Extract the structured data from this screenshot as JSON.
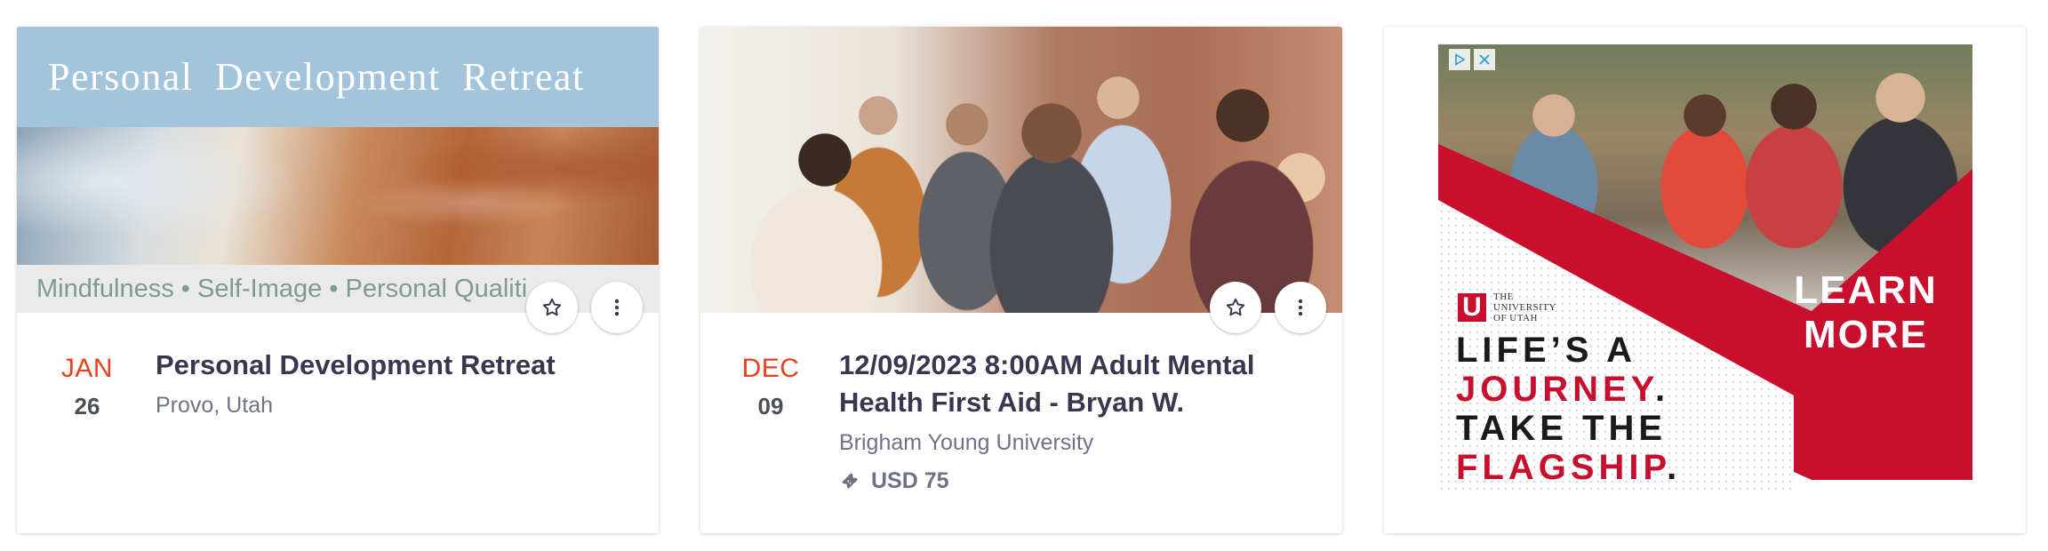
{
  "colors": {
    "date_month": "#e4421f",
    "title_text": "#39364f",
    "muted_text": "#6f7287",
    "ad_red": "#c8102e"
  },
  "events": [
    {
      "banner": {
        "title": "Personal Development Retreat",
        "subtitle": "Mindfulness • Self-Image • Personal Qualiti"
      },
      "month": "JAN",
      "day": "26",
      "title": "Personal Development Retreat",
      "location": "Provo, Utah",
      "icons": [
        "star-icon",
        "more-vertical-icon"
      ]
    },
    {
      "month": "DEC",
      "day": "09",
      "title": "12/09/2023 8:00AM Adult Mental Health First Aid - Bryan W.",
      "location": "Brigham Young University",
      "price": "USD 75",
      "icons": [
        "star-icon",
        "more-vertical-icon",
        "ticket-icon"
      ]
    }
  ],
  "ad": {
    "cta_line1": "LEARN",
    "cta_line2": "MORE",
    "logo_mark": "U",
    "logo_line1": "THE",
    "logo_line2": "UNIVERSITY",
    "logo_line3": "OF UTAH",
    "tagline_1a": "LIFE’S A",
    "tagline_2a": "JOURNEY",
    "tagline_2b": ".",
    "tagline_3a": "TAKE THE",
    "tagline_4a": "FLAGSHIP",
    "tagline_4b": ".",
    "icons": [
      "adchoices-icon",
      "close-icon"
    ]
  }
}
